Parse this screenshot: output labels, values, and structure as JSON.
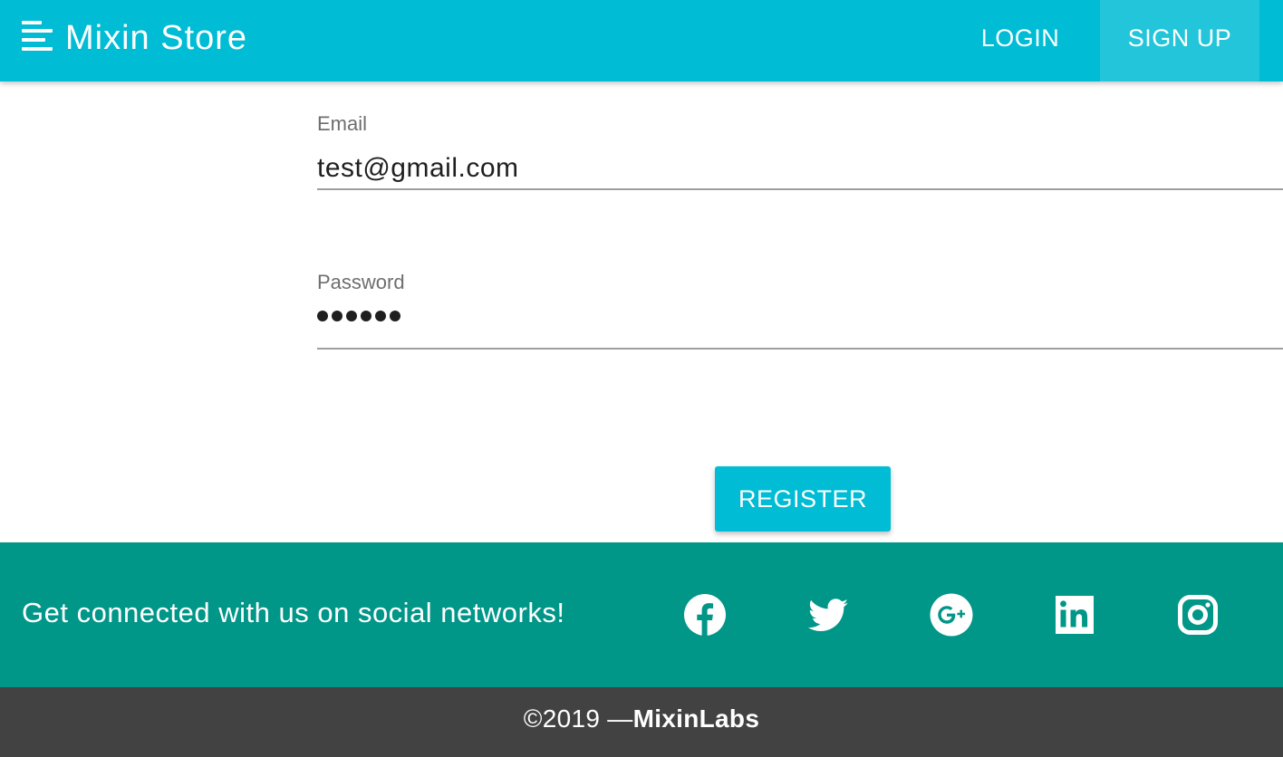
{
  "navbar": {
    "menu_icon": "hamburger-menu-icon",
    "brand": "Mixin Store",
    "login_label": "LOGIN",
    "signup_label": "SIGN UP"
  },
  "form": {
    "email_label": "Email",
    "email_value": "test@gmail.com",
    "password_label": "Password",
    "password_length": 6,
    "register_label": "REGISTER"
  },
  "social": {
    "text": "Get connected with us on social networks!",
    "icons": [
      "facebook-icon",
      "twitter-icon",
      "google-plus-icon",
      "linkedin-icon",
      "instagram-icon"
    ]
  },
  "footer": {
    "copyright_prefix": "©2019 —",
    "company": "MixinLabs"
  },
  "colors": {
    "primary": "#00bcd4",
    "signup_highlight": "#23c5da",
    "social_band": "#009688",
    "copyright_bar": "#424242"
  }
}
